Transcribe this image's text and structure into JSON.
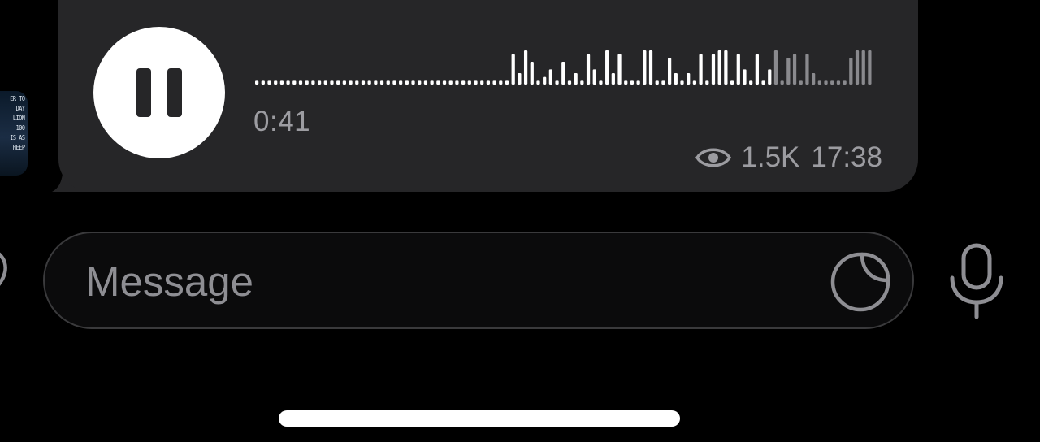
{
  "avatar": {
    "lines": [
      "ER TO",
      "DAY",
      "LION",
      "100",
      "IS AS",
      "HEEP"
    ]
  },
  "voice_message": {
    "duration": "0:41",
    "views": "1.5K",
    "time": "17:38",
    "playing": true,
    "progress": 0.84,
    "waveform": [
      1,
      1,
      1,
      1,
      1,
      1,
      1,
      1,
      1,
      1,
      1,
      1,
      1,
      1,
      1,
      1,
      1,
      1,
      1,
      1,
      1,
      1,
      1,
      1,
      1,
      1,
      1,
      1,
      1,
      1,
      1,
      1,
      1,
      1,
      1,
      1,
      1,
      1,
      1,
      1,
      1,
      8,
      3,
      9,
      6,
      1,
      2,
      4,
      1,
      6,
      1,
      3,
      1,
      8,
      4,
      1,
      9,
      3,
      8,
      1,
      1,
      1,
      9,
      9,
      1,
      1,
      7,
      3,
      1,
      3,
      1,
      8,
      1,
      8,
      9,
      9,
      1,
      8,
      4,
      1,
      8,
      1,
      4,
      9,
      1,
      7,
      8,
      1,
      8,
      3,
      1,
      1,
      1,
      1,
      1,
      7,
      9,
      9,
      9
    ],
    "colors": {
      "played": "#ffffff",
      "unplayed": "#8a8a8e",
      "bubble": "#262628"
    }
  },
  "composer": {
    "placeholder": "Message"
  },
  "icons": {
    "attach": "attach-icon",
    "sticker": "sticker-icon",
    "mic": "microphone-icon",
    "eye": "eye-icon",
    "pause": "pause-icon"
  }
}
